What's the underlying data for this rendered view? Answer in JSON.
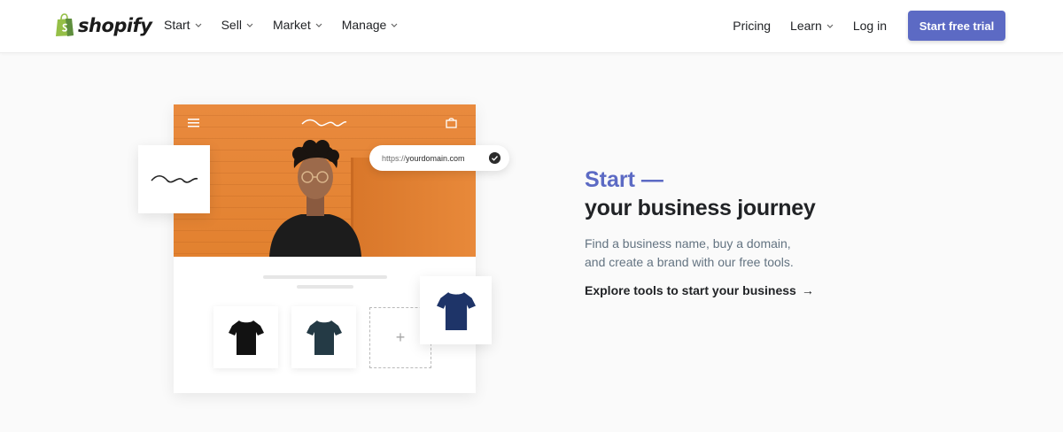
{
  "brand": {
    "name": "shopify",
    "accent_color": "#5c6ac4",
    "logo_green": "#95bf47"
  },
  "nav": {
    "left": [
      {
        "label": "Start"
      },
      {
        "label": "Sell"
      },
      {
        "label": "Market"
      },
      {
        "label": "Manage"
      }
    ],
    "pricing": "Pricing",
    "learn": "Learn",
    "login": "Log in",
    "cta": "Start free trial"
  },
  "illustration": {
    "url_prefix": "https://",
    "url_domain": "yourdomain.com",
    "add_symbol": "+"
  },
  "content": {
    "heading_accent": "Start —",
    "heading": "your business journey",
    "description_line1": "Find a business name, buy a domain,",
    "description_line2": "and create a brand with our free tools.",
    "link": "Explore tools to start your business",
    "link_arrow": "→"
  }
}
